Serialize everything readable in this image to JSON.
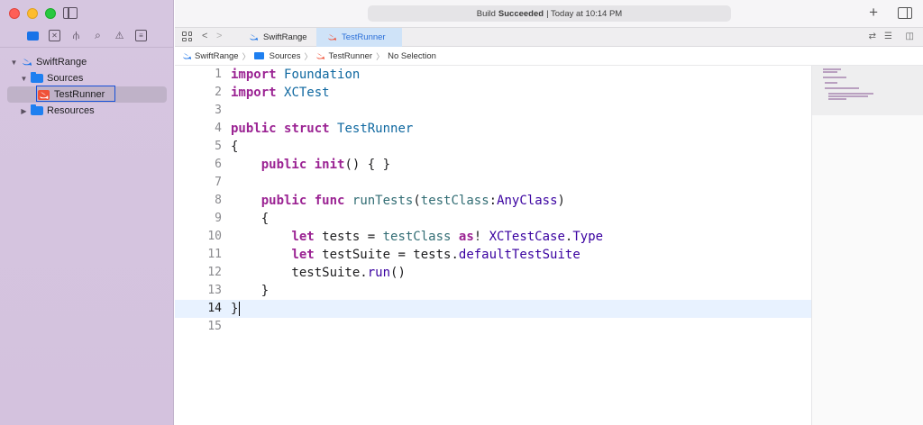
{
  "window": {
    "status": {
      "prefix": "Build",
      "bold": "Succeeded",
      "suffix": "| Today at 10:14 PM"
    }
  },
  "navigator": {
    "icons": [
      "folder-icon",
      "source-control-icon",
      "symbol-icon",
      "search-icon",
      "issue-icon",
      "test-icon"
    ],
    "tree": [
      {
        "label": "SwiftRange",
        "kind": "project",
        "expanded": true,
        "depth": 0
      },
      {
        "label": "Sources",
        "kind": "folder",
        "expanded": true,
        "depth": 1
      },
      {
        "label": "TestRunner",
        "kind": "swift-file",
        "selected": true,
        "depth": 2
      },
      {
        "label": "Resources",
        "kind": "folder",
        "expanded": false,
        "depth": 1
      }
    ]
  },
  "tabs": [
    {
      "label": "SwiftRange",
      "active": false
    },
    {
      "label": "TestRunner",
      "active": true
    }
  ],
  "breadcrumb": [
    "SwiftRange",
    "Sources",
    "TestRunner",
    "No Selection"
  ],
  "editor": {
    "current_line": 14,
    "lines": [
      {
        "n": "1",
        "text": "import Foundation"
      },
      {
        "n": "2",
        "text": "import XCTest"
      },
      {
        "n": "3",
        "text": ""
      },
      {
        "n": "4",
        "text": "public struct TestRunner"
      },
      {
        "n": "5",
        "text": "{"
      },
      {
        "n": "6",
        "text": "    public init() { }"
      },
      {
        "n": "7",
        "text": ""
      },
      {
        "n": "8",
        "text": "    public func runTests(testClass:AnyClass)"
      },
      {
        "n": "9",
        "text": "    {"
      },
      {
        "n": "10",
        "text": "        let tests = testClass as! XCTestCase.Type"
      },
      {
        "n": "11",
        "text": "        let testSuite = tests.defaultTestSuite"
      },
      {
        "n": "12",
        "text": "        testSuite.run()"
      },
      {
        "n": "13",
        "text": "    }"
      },
      {
        "n": "14",
        "text": "}"
      },
      {
        "n": "15",
        "text": ""
      }
    ]
  },
  "colors": {
    "accent": "#1750d8",
    "keyword": "#9b2393",
    "type": "#0f68a0",
    "func": "#326d74",
    "class": "#3900a0"
  }
}
